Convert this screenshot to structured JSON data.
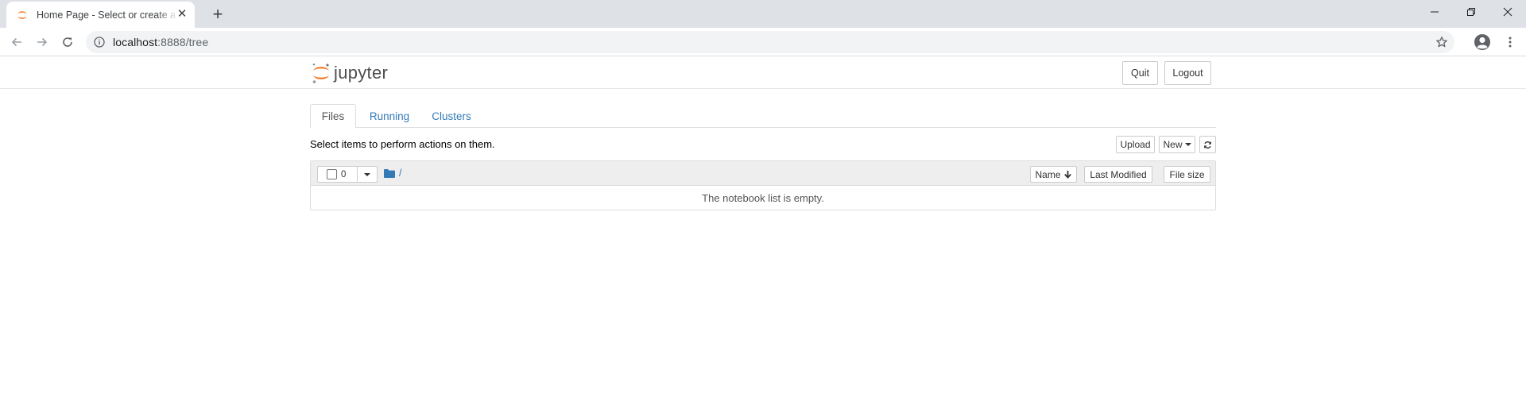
{
  "browser": {
    "tab_title": "Home Page - Select or create a notebook",
    "url_host": "localhost",
    "url_rest": ":8888/tree"
  },
  "header": {
    "logo_text": "jupyter",
    "quit_label": "Quit",
    "logout_label": "Logout"
  },
  "tabs": [
    {
      "label": "Files",
      "active": true
    },
    {
      "label": "Running",
      "active": false
    },
    {
      "label": "Clusters",
      "active": false
    }
  ],
  "toolbar": {
    "hint": "Select items to perform actions on them.",
    "upload_label": "Upload",
    "new_label": "New"
  },
  "list": {
    "selected_count": "0",
    "breadcrumb": "/",
    "columns": {
      "name": "Name",
      "last_modified": "Last Modified",
      "file_size": "File size"
    },
    "empty_message": "The notebook list is empty."
  },
  "colors": {
    "accent_link": "#337ab7",
    "jupyter_orange": "#f37726",
    "tabstrip_bg": "#dee1e6"
  }
}
